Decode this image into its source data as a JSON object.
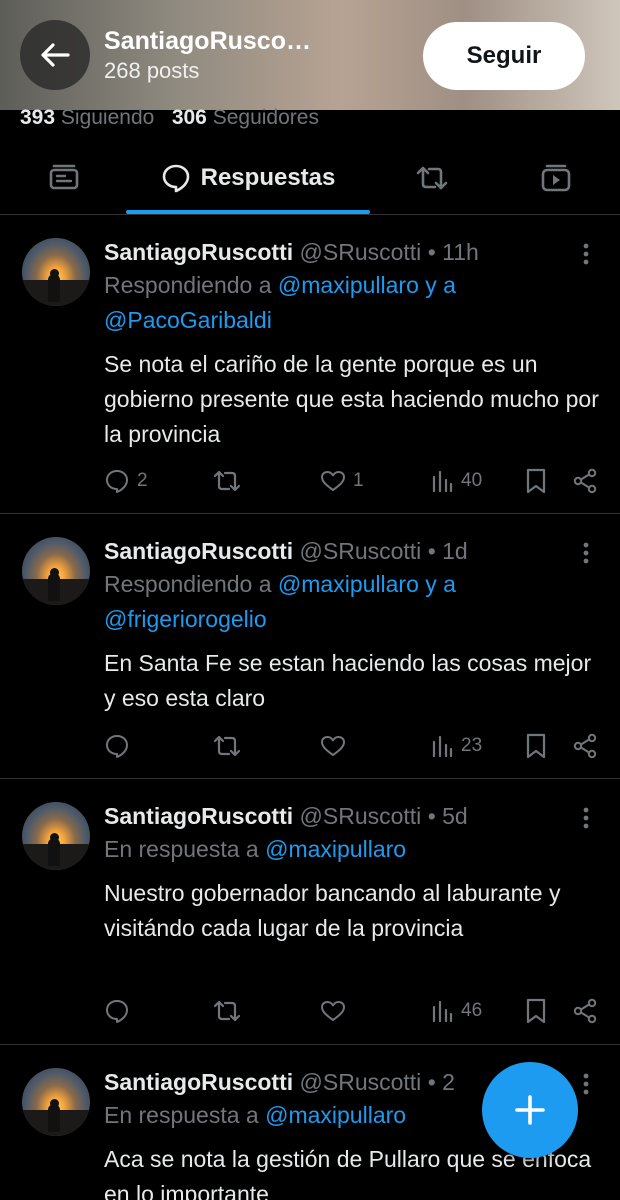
{
  "header": {
    "name": "SantiagoRusco…",
    "posts_count": "268 posts",
    "follow_label": "Seguir"
  },
  "stats": {
    "following_count": "393",
    "following_label": "Siguiendo",
    "followers_count": "306",
    "followers_label": "Seguidores"
  },
  "tabs": {
    "active_label": "Respuestas",
    "icons": [
      "posts-icon",
      "chat-bubble-icon",
      "repost-icon",
      "video-icon"
    ]
  },
  "posts": [
    {
      "name": "SantiagoRuscotti",
      "handle": "@SRuscotti",
      "dot": "•",
      "time": "11h",
      "reply_prefix": "Respondiendo a",
      "mention1": "@maxipullaro",
      "joiner": "y a",
      "mention2": "@PacoGaribaldi",
      "text": "Se nota el cariño de la gente porque es un gobierno presente que esta haciendo mucho por la provincia",
      "replies": "2",
      "reposts": "",
      "likes": "1",
      "views": "40"
    },
    {
      "name": "SantiagoRuscotti",
      "handle": "@SRuscotti",
      "dot": "•",
      "time": "1d",
      "reply_prefix": "Respondiendo a",
      "mention1": "@maxipullaro",
      "joiner": "y a",
      "mention2": "@frigeriorogelio",
      "text": "En Santa Fe se estan haciendo las cosas mejor y eso esta claro",
      "replies": "",
      "reposts": "",
      "likes": "",
      "views": "23"
    },
    {
      "name": "SantiagoRuscotti",
      "handle": "@SRuscotti",
      "dot": "•",
      "time": "5d",
      "reply_prefix": "En respuesta a",
      "mention1": "@maxipullaro",
      "text": "Nuestro gobernador bancando al laburante y visitándo cada lugar de la provincia",
      "replies": "",
      "reposts": "",
      "likes": "",
      "views": "46"
    },
    {
      "name": "SantiagoRuscotti",
      "handle": "@SRuscotti",
      "dot": "•",
      "time": "2",
      "reply_prefix": "En respuesta a",
      "mention1": "@maxipullaro",
      "text": "Aca se nota la gestión de Pullaro que se enfoca en lo importante"
    }
  ],
  "colors": {
    "accent": "#1d9bf0",
    "secondary_text": "#71767b",
    "primary_text": "#e7e9ea",
    "divider": "#2f3336"
  }
}
